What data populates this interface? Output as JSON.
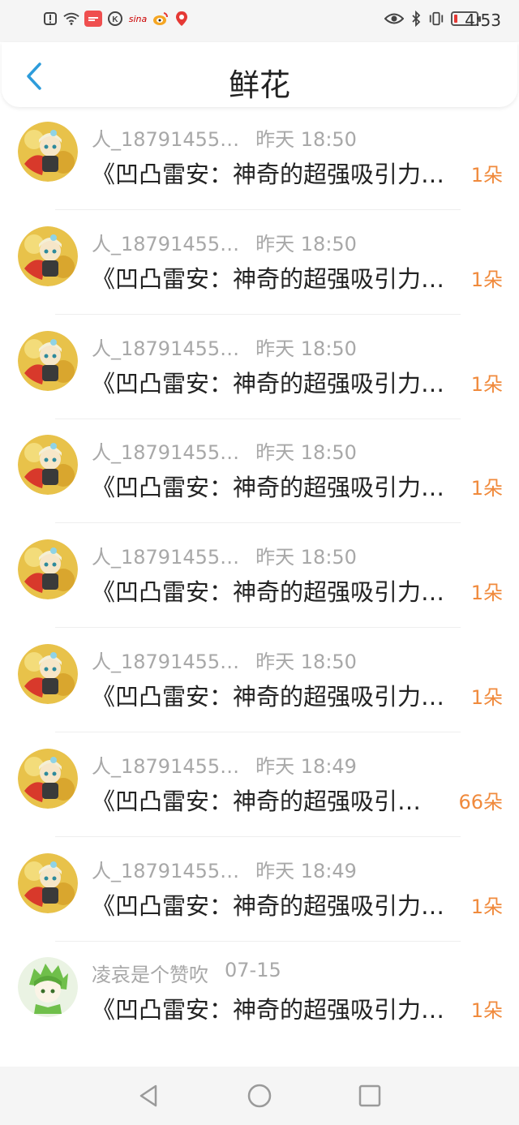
{
  "status_bar": {
    "time": "4:53",
    "app_weibo": "微博",
    "app_sina": "sina"
  },
  "header": {
    "title": "鲜花"
  },
  "list": {
    "rows": [
      {
        "name": "",
        "time": "",
        "title": "《凹凸雷安：神奇的超强吸引力…",
        "count": "1朵",
        "avatar": "character"
      },
      {
        "name": "人_18791455…",
        "time": "昨天 18:50",
        "title": "《凹凸雷安：神奇的超强吸引力…",
        "count": "1朵",
        "avatar": "character"
      },
      {
        "name": "人_18791455…",
        "time": "昨天 18:50",
        "title": "《凹凸雷安：神奇的超强吸引力…",
        "count": "1朵",
        "avatar": "character"
      },
      {
        "name": "人_18791455…",
        "time": "昨天 18:50",
        "title": "《凹凸雷安：神奇的超强吸引力…",
        "count": "1朵",
        "avatar": "character"
      },
      {
        "name": "人_18791455…",
        "time": "昨天 18:50",
        "title": "《凹凸雷安：神奇的超强吸引力…",
        "count": "1朵",
        "avatar": "character"
      },
      {
        "name": "人_18791455…",
        "time": "昨天 18:50",
        "title": "《凹凸雷安：神奇的超强吸引力…",
        "count": "1朵",
        "avatar": "character"
      },
      {
        "name": "人_18791455…",
        "time": "昨天 18:50",
        "title": "《凹凸雷安：神奇的超强吸引力…",
        "count": "1朵",
        "avatar": "character"
      },
      {
        "name": "人_18791455…",
        "time": "昨天 18:49",
        "title": "《凹凸雷安：神奇的超强吸引…",
        "count": "66朵",
        "avatar": "character"
      },
      {
        "name": "人_18791455…",
        "time": "昨天 18:49",
        "title": "《凹凸雷安：神奇的超强吸引力…",
        "count": "1朵",
        "avatar": "character"
      },
      {
        "name": "凌哀是个赞吹",
        "time": "07-15",
        "title": "《凹凸雷安：神奇的超强吸引力…",
        "count": "1朵",
        "avatar": "green"
      }
    ]
  },
  "colors": {
    "accent": "#2d9cdb",
    "count": "#f08a3c",
    "meta": "#a8a8a8"
  }
}
